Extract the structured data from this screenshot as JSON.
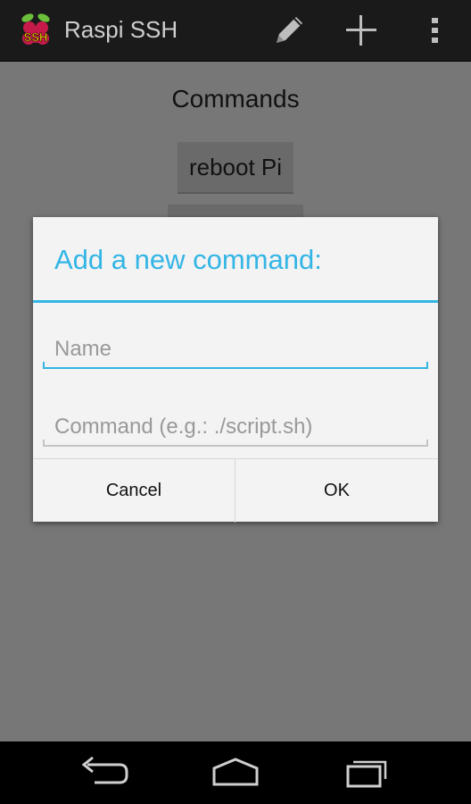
{
  "actionbar": {
    "app_title": "Raspi SSH",
    "icons": {
      "app": "raspberry-ssh-icon",
      "edit": "pencil-icon",
      "add": "plus-icon",
      "more": "overflow-menu-icon"
    },
    "app_icon_text": "SSH"
  },
  "content": {
    "title": "Commands",
    "commands": [
      {
        "label": "reboot Pi"
      },
      {
        "label": ""
      }
    ]
  },
  "dialog": {
    "title": "Add a new command:",
    "name_field": {
      "value": "",
      "placeholder": "Name"
    },
    "command_field": {
      "value": "",
      "placeholder": "Command (e.g.: ./script.sh)"
    },
    "cancel_label": "Cancel",
    "ok_label": "OK"
  },
  "navbar": {
    "icons": {
      "back": "back-icon",
      "home": "home-icon",
      "recent": "recent-apps-icon"
    }
  },
  "colors": {
    "accent": "#33b5e5",
    "actionbar_bg": "#1a1a1a",
    "dim_bg": "#777777",
    "dialog_bg": "#f3f3f3"
  }
}
